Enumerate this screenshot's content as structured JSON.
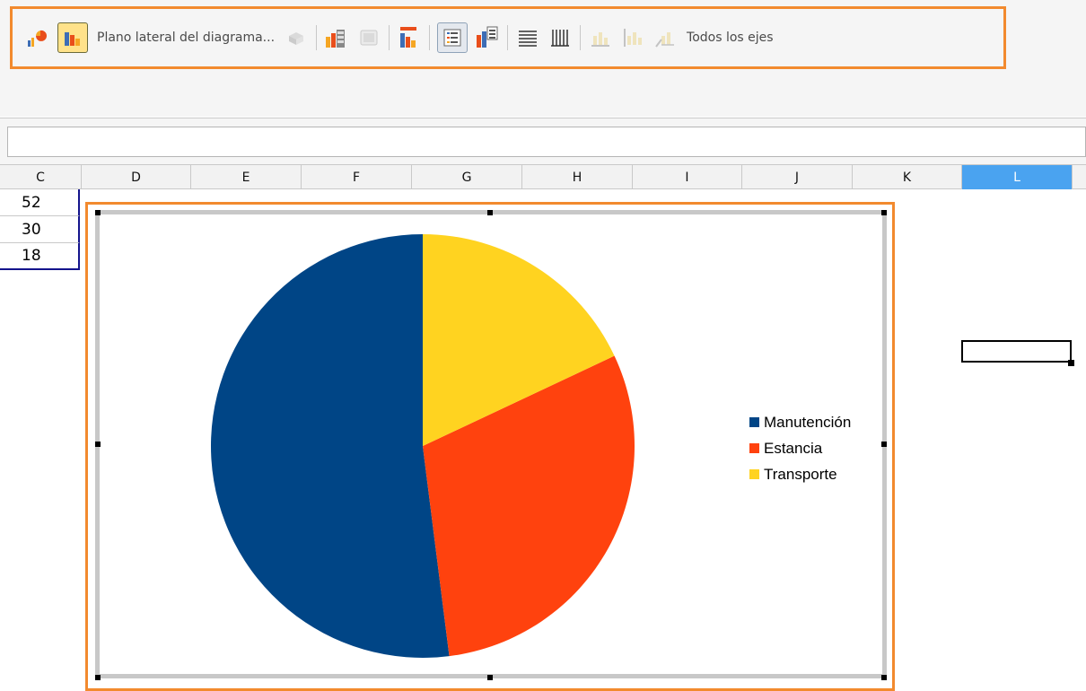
{
  "toolbar": {
    "chart_wall_label": "Plano lateral del diagrama...",
    "all_axes_label": "Todos los ejes",
    "accent_color": "#f28a2e"
  },
  "formula_bar": {
    "value": ""
  },
  "columns": [
    "C",
    "D",
    "E",
    "F",
    "G",
    "H",
    "I",
    "J",
    "K",
    "L"
  ],
  "selected_column": "L",
  "cells": {
    "values": [
      "52",
      "30",
      "18"
    ]
  },
  "chart_data": {
    "type": "pie",
    "categories": [
      "Manutención",
      "Estancia",
      "Transporte"
    ],
    "values": [
      52,
      30,
      18
    ],
    "colors": [
      "#004586",
      "#ff420e",
      "#ffd320"
    ],
    "legend": "right"
  }
}
